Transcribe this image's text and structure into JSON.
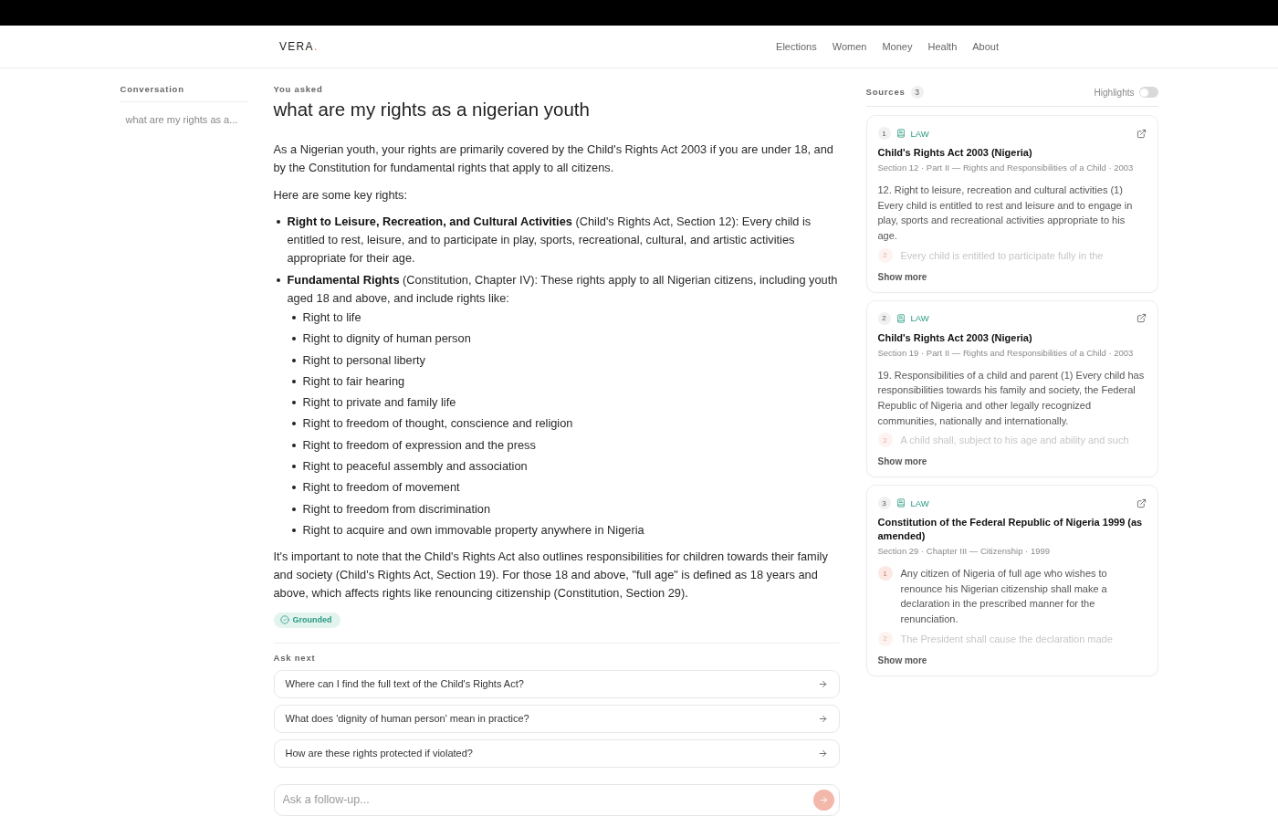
{
  "header": {
    "logo": {
      "text": "VERA",
      "mark": "."
    },
    "nav": [
      "Elections",
      "Women",
      "Money",
      "Health",
      "About"
    ]
  },
  "sidebar": {
    "title": "Conversation",
    "items": [
      {
        "label": "what are my rights as a...",
        "selected": false
      }
    ]
  },
  "question": {
    "label": "You asked",
    "text": "what are my rights as a nigerian youth"
  },
  "answer": {
    "blocks": [
      {
        "kind": "paragraph",
        "text": "As a Nigerian youth, your rights are primarily covered by the Child's Rights Act 2003 if you are under 18, and by the Constitution for fundamental rights that apply to all citizens."
      },
      {
        "kind": "paragraph",
        "text": "Here are some key rights:"
      },
      {
        "kind": "list",
        "items": [
          {
            "text": "**Right to Leisure, Recreation, and Cultural Activities** (Child's Rights Act, Section 12): Every child is entitled to rest, leisure, and to participate in play, sports, recreational, cultural, and artistic activities appropriate for their age."
          },
          {
            "text": "**Fundamental Rights** (Constitution, Chapter IV): These rights apply to all Nigerian citizens, including youth aged 18 and above, and include rights like:",
            "children": [
              {
                "text": "Right to life"
              },
              {
                "text": "Right to dignity of human person"
              },
              {
                "text": "Right to personal liberty"
              },
              {
                "text": "Right to fair hearing"
              },
              {
                "text": "Right to private and family life"
              },
              {
                "text": "Right to freedom of thought, conscience and religion"
              },
              {
                "text": "Right to freedom of expression and the press"
              },
              {
                "text": "Right to peaceful assembly and association"
              },
              {
                "text": "Right to freedom of movement"
              },
              {
                "text": "Right to freedom from discrimination"
              },
              {
                "text": "Right to acquire and own immovable property anywhere in Nigeria"
              }
            ]
          }
        ]
      },
      {
        "kind": "paragraph",
        "text": "It's important to note that the Child's Rights Act also outlines responsibilities for children towards their family and society (Child's Rights Act, Section 19). For those 18 and above, \"full age\" is defined as 18 years and above, which affects rights like renouncing citizenship (Constitution, Section 29)."
      }
    ]
  },
  "status": {
    "kind": "grounded",
    "label": "Grounded"
  },
  "ask_next": {
    "title": "Ask next",
    "suggestions": [
      "Where can I find the full text of the Child's Rights Act?",
      "What does 'dignity of human person' mean in practice?",
      "How are these rights protected if violated?"
    ]
  },
  "composer": {
    "placeholder": "Ask a follow-up...",
    "send_button": {
      "disabled": true
    }
  },
  "sources": {
    "title": "Sources",
    "count": "3",
    "highlights": {
      "label": "Highlights",
      "on": false
    },
    "cards": [
      {
        "number": "1",
        "type": "LAW",
        "title": "Child's Rights Act 2003 (Nigeria)",
        "meta": "Section 12 · Part II — Rights and Responsibilities of a Child · 2003",
        "passages": [
          {
            "text": "12. Right to leisure, recreation and cultural activities (1) Every child is entitled to rest and leisure and to engage in play, sports and recreational activities appropriate to his age."
          }
        ],
        "preview": {
          "number": "2",
          "text": "Every child is entitled to participate fully in the"
        },
        "more": "Show more"
      },
      {
        "number": "2",
        "type": "LAW",
        "title": "Child's Rights Act 2003 (Nigeria)",
        "meta": "Section 19 · Part II — Rights and Responsibilities of a Child · 2003",
        "passages": [
          {
            "text": "19. Responsibilities of a child and parent (1) Every child has responsibilities towards his family and society, the Federal Republic of Nigeria and other legally recognized communities, nationally and internationally."
          }
        ],
        "preview": {
          "number": "2",
          "text": "A child shall, subject to his age and ability and such"
        },
        "more": "Show more"
      },
      {
        "number": "3",
        "type": "LAW",
        "title": "Constitution of the Federal Republic of Nigeria 1999 (as amended)",
        "meta": "Section 29 · Chapter III — Citizenship · 1999",
        "passages": [
          {
            "number": "1",
            "text": "Any citizen of Nigeria of full age who wishes to renounce his Nigerian citizenship shall make a declaration in the prescribed manner for the renunciation."
          }
        ],
        "preview": {
          "number": "2",
          "text": "The President shall cause the declaration made"
        },
        "more": "Show more"
      }
    ]
  }
}
